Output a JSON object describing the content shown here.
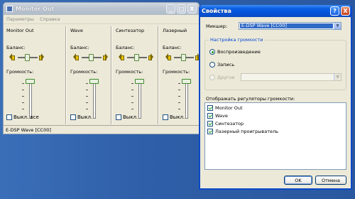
{
  "mixer": {
    "title": "Monitor Out",
    "menu": [
      "Параметры",
      "Справка"
    ],
    "channels": [
      {
        "name": "Monitor Out",
        "balance_label": "Баланс:",
        "volume_label": "Громкость:",
        "checkbox_label": "Выкл. все"
      },
      {
        "name": "Wave",
        "balance_label": "Баланс:",
        "volume_label": "Громкость:",
        "checkbox_label": "Выкл."
      },
      {
        "name": "Синтезатор",
        "balance_label": "Баланс:",
        "volume_label": "Громкость:",
        "checkbox_label": "Выкл."
      },
      {
        "name": "Лазерный",
        "balance_label": "Баланс:",
        "volume_label": "Громкость:",
        "checkbox_label": "Выкл."
      }
    ],
    "status": "E-DSP Wave [CC00]"
  },
  "props": {
    "title": "Свойства",
    "help_button": "?",
    "close_button": "X",
    "mixer_label": "Микшер:",
    "mixer_value": "E-DSP Wave [CC00]",
    "group_title": "Настройка громкости",
    "radio_playback": "Воспроизведение",
    "radio_record": "Запись",
    "radio_other": "Другое",
    "list_label": "Отображать регуляторы громкости:",
    "list_items": [
      "Monitor Out",
      "Wave",
      "Синтезатор",
      "Лазерный проигрыватель"
    ],
    "ok": "OK",
    "cancel": "Отмена"
  },
  "window_buttons": {
    "minimize": "_",
    "maximize": "□",
    "close": "X"
  }
}
